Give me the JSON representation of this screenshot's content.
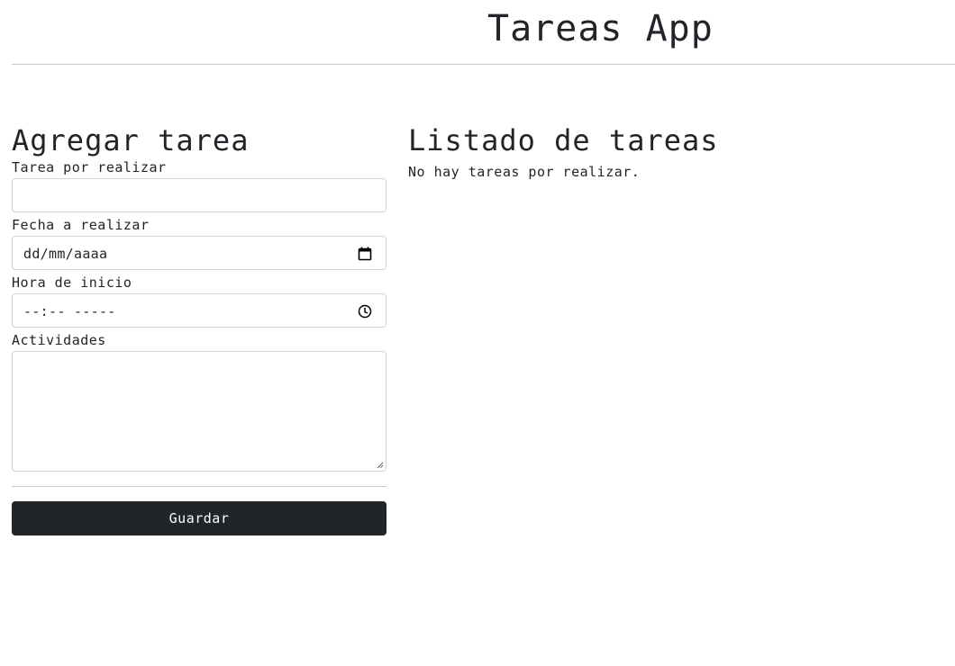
{
  "header": {
    "title": "Tareas App"
  },
  "form": {
    "title": "Agregar tarea",
    "fields": {
      "task": {
        "label": "Tarea por realizar",
        "value": ""
      },
      "date": {
        "label": "Fecha a realizar",
        "value": "dd/mm/aaaa",
        "icon": "calendar-icon"
      },
      "time": {
        "label": "Hora de inicio",
        "value": "--:-- -----",
        "icon": "clock-icon"
      },
      "activities": {
        "label": "Actividades",
        "value": ""
      }
    },
    "save_label": "Guardar"
  },
  "list": {
    "title": "Listado de tareas",
    "empty_message": "No hay tareas por realizar."
  },
  "colors": {
    "text": "#212529",
    "button_bg": "#212529",
    "button_text": "#ffffff",
    "border": "#ced4da",
    "divider": "#c9cbcd"
  }
}
